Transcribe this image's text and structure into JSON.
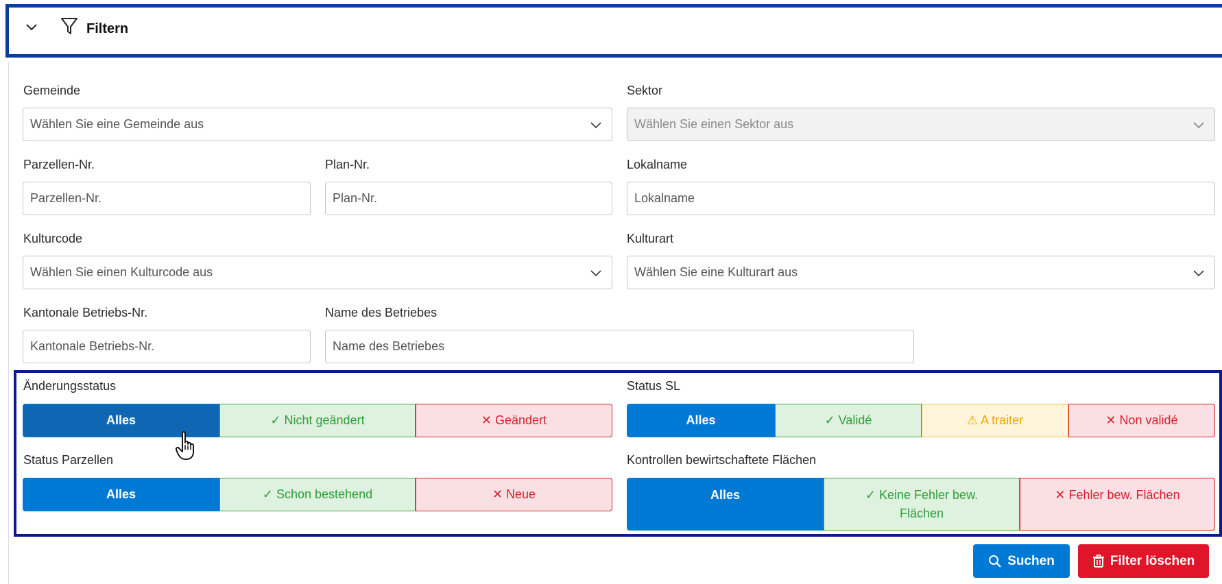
{
  "header": {
    "title": "Filtern",
    "toggle_icon": "chevron-down-icon",
    "icon": "funnel-icon"
  },
  "gemeinde": {
    "label": "Gemeinde",
    "value": "Wählen Sie eine Gemeinde aus"
  },
  "sektor": {
    "label": "Sektor",
    "value": "Wählen Sie einen Sektor aus"
  },
  "parzellen": {
    "label": "Parzellen-Nr.",
    "placeholder": "Parzellen-Nr."
  },
  "plan": {
    "label": "Plan-Nr.",
    "placeholder": "Plan-Nr."
  },
  "lokalname": {
    "label": "Lokalname",
    "placeholder": "Lokalname"
  },
  "kulturcode": {
    "label": "Kulturcode",
    "value": "Wählen Sie einen Kulturcode aus"
  },
  "kulturart": {
    "label": "Kulturart",
    "value": "Wählen Sie eine Kulturart aus"
  },
  "betriebsnr": {
    "label": "Kantonale Betriebs-Nr.",
    "placeholder": "Kantonale Betriebs-Nr."
  },
  "betriebname": {
    "label": "Name des Betriebes",
    "placeholder": "Name des Betriebes"
  },
  "aenderungsstatus": {
    "label": "Änderungsstatus",
    "options": [
      "Alles",
      "✓ Nicht geändert",
      "✕ Geändert"
    ]
  },
  "status_sl": {
    "label": "Status SL",
    "options": [
      "Alles",
      "✓ Validé",
      "⚠ A traiter",
      "✕ Non validé"
    ]
  },
  "status_parzellen": {
    "label": "Status Parzellen",
    "options": [
      "Alles",
      "✓ Schon bestehend",
      "✕ Neue"
    ]
  },
  "kontrollen": {
    "label": "Kontrollen bewirtschaftete Flächen",
    "options": [
      "Alles",
      "✓ Keine Fehler bew. Flächen",
      "✕ Fehler bew. Flächen"
    ]
  },
  "buttons": {
    "search": "Suchen",
    "clear": "Filter löschen"
  },
  "colors": {
    "primary": "#0079d4",
    "success": "#36a845",
    "danger": "#d6202f",
    "warning": "#f0a500",
    "frame": "#0a3d9e"
  }
}
